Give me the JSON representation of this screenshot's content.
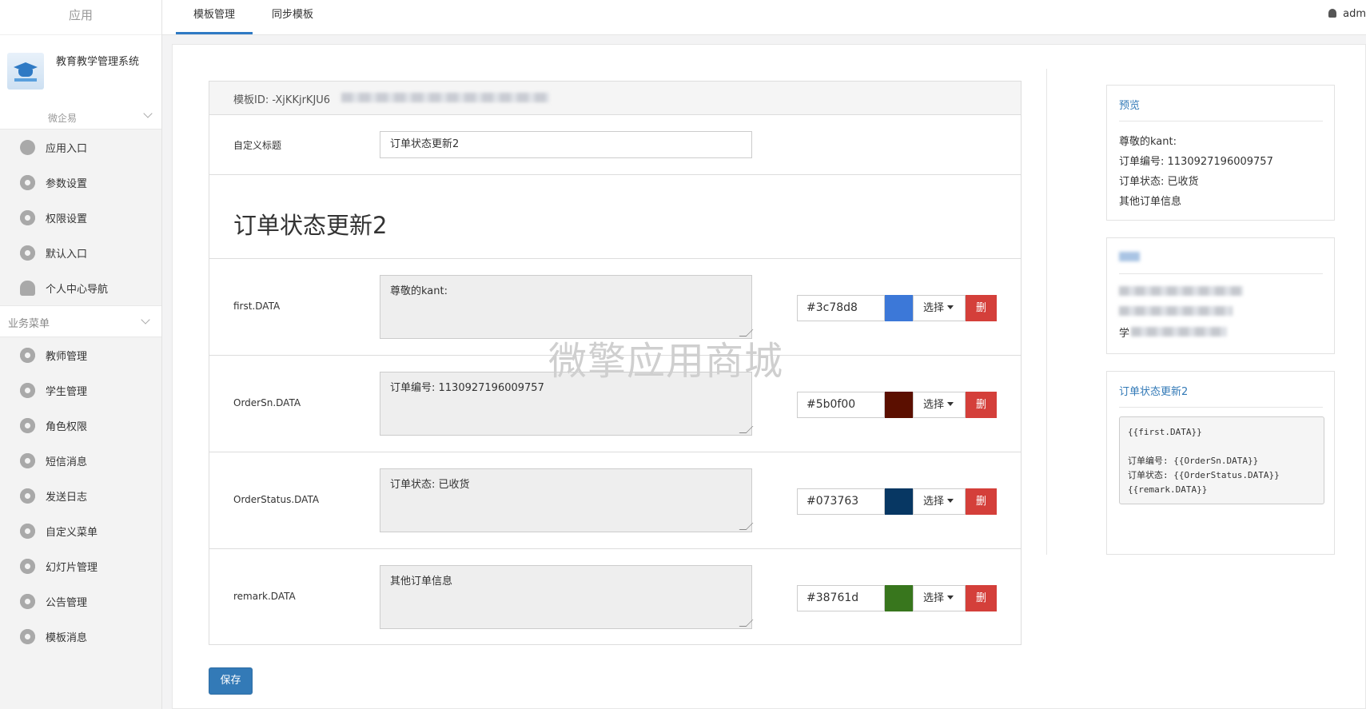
{
  "sidebar": {
    "header": "应用",
    "app_name": "教育教学管理系统",
    "sub_header": "微企易",
    "items": [
      {
        "label": "应用入口",
        "icon": "chat-icon"
      },
      {
        "label": "参数设置",
        "icon": "gear-icon"
      },
      {
        "label": "权限设置",
        "icon": "gear-icon"
      },
      {
        "label": "默认入口",
        "icon": "gear-icon"
      },
      {
        "label": "个人中心导航",
        "icon": "user-icon"
      }
    ],
    "group_header": "业务菜单",
    "group_items": [
      {
        "label": "教师管理"
      },
      {
        "label": "学生管理"
      },
      {
        "label": "角色权限"
      },
      {
        "label": "短信消息"
      },
      {
        "label": "发送日志"
      },
      {
        "label": "自定义菜单"
      },
      {
        "label": "幻灯片管理"
      },
      {
        "label": "公告管理"
      },
      {
        "label": "模板消息"
      }
    ]
  },
  "topbar": {
    "tabs": [
      {
        "label": "模板管理"
      },
      {
        "label": "同步模板"
      }
    ],
    "user": "adm"
  },
  "form": {
    "template_id_label": "模板ID: -XjKKjrKJU6",
    "custom_title_label": "自定义标题",
    "custom_title_value": "订单状态更新2",
    "big_title": "订单状态更新2",
    "fields": [
      {
        "key": "first.DATA",
        "text": "尊敬的kant:",
        "color": "#3c78d8"
      },
      {
        "key": "OrderSn.DATA",
        "text": "订单编号: 1130927196009757",
        "color": "#5b0f00"
      },
      {
        "key": "OrderStatus.DATA",
        "text": "订单状态: 已收货",
        "color": "#073763"
      },
      {
        "key": "remark.DATA",
        "text": "其他订单信息",
        "color": "#38761d"
      }
    ],
    "select_label": "选择",
    "delete_label": "删",
    "save_label": "保存"
  },
  "watermark": "微擎应用商城",
  "preview": {
    "title": "预览",
    "lines": [
      "尊敬的kant:",
      "订单编号: 1130927196009757",
      "订单状态: 已收货",
      "其他订单信息"
    ]
  },
  "blurred_panel": {
    "partial_char": "学"
  },
  "template_panel": {
    "title": "订单状态更新2",
    "code": "{{first.DATA}}\n\n订单编号: {{OrderSn.DATA}}\n订单状态: {{OrderStatus.DATA}}\n{{remark.DATA}}"
  }
}
